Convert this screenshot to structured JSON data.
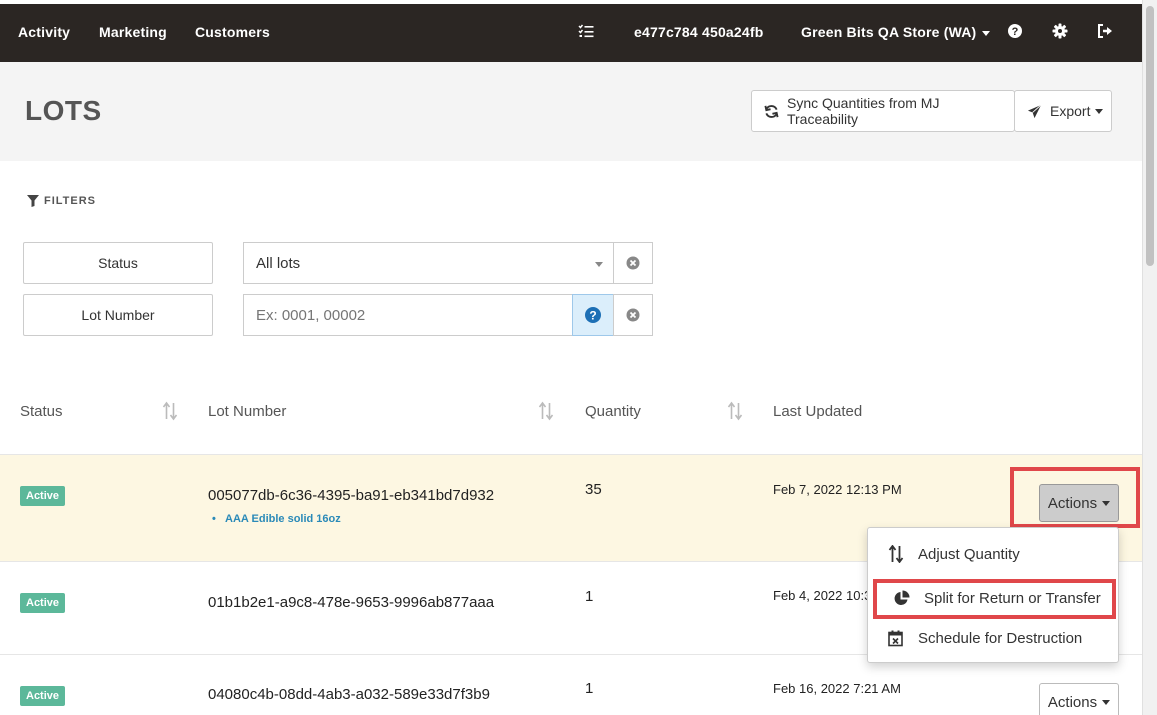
{
  "nav": {
    "items": [
      "Activity",
      "Marketing",
      "Customers"
    ],
    "session_id": "e477c784 450a24fb",
    "store": "Green Bits QA Store (WA)"
  },
  "header": {
    "title": "LOTS",
    "sync_label": "Sync Quantities from MJ Traceability",
    "export_label": "Export"
  },
  "filters": {
    "label": "FILTERS",
    "status_label": "Status",
    "status_value": "All lots",
    "lot_label": "Lot Number",
    "lot_placeholder": "Ex: 0001, 00002"
  },
  "table": {
    "columns": [
      "Status",
      "Lot Number",
      "Quantity",
      "Last Updated"
    ],
    "rows": [
      {
        "status": "Active",
        "lot": "005077db-6c36-4395-ba91-eb341bd7d932",
        "product": "AAA Edible solid 16oz",
        "qty": "35",
        "updated": "Feb 7, 2022 12:13 PM"
      },
      {
        "status": "Active",
        "lot": "01b1b2e1-a9c8-478e-9653-9996ab877aaa",
        "product": "",
        "qty": "1",
        "updated": "Feb 4, 2022 10:3"
      },
      {
        "status": "Active",
        "lot": "04080c4b-08dd-4ab3-a032-589e33d7f3b9",
        "product": "",
        "qty": "1",
        "updated": "Feb 16, 2022 7:21 AM"
      }
    ],
    "actions_label": "Actions"
  },
  "dropdown": {
    "items": [
      "Adjust Quantity",
      "Split for Return or Transfer",
      "Schedule for Destruction"
    ]
  },
  "colors": {
    "nav_bg": "#2b2623",
    "active_badge": "#5cb89a",
    "highlight_row": "#fdf7e2",
    "highlight_border": "#e0474a",
    "link": "#2a8ab8"
  }
}
